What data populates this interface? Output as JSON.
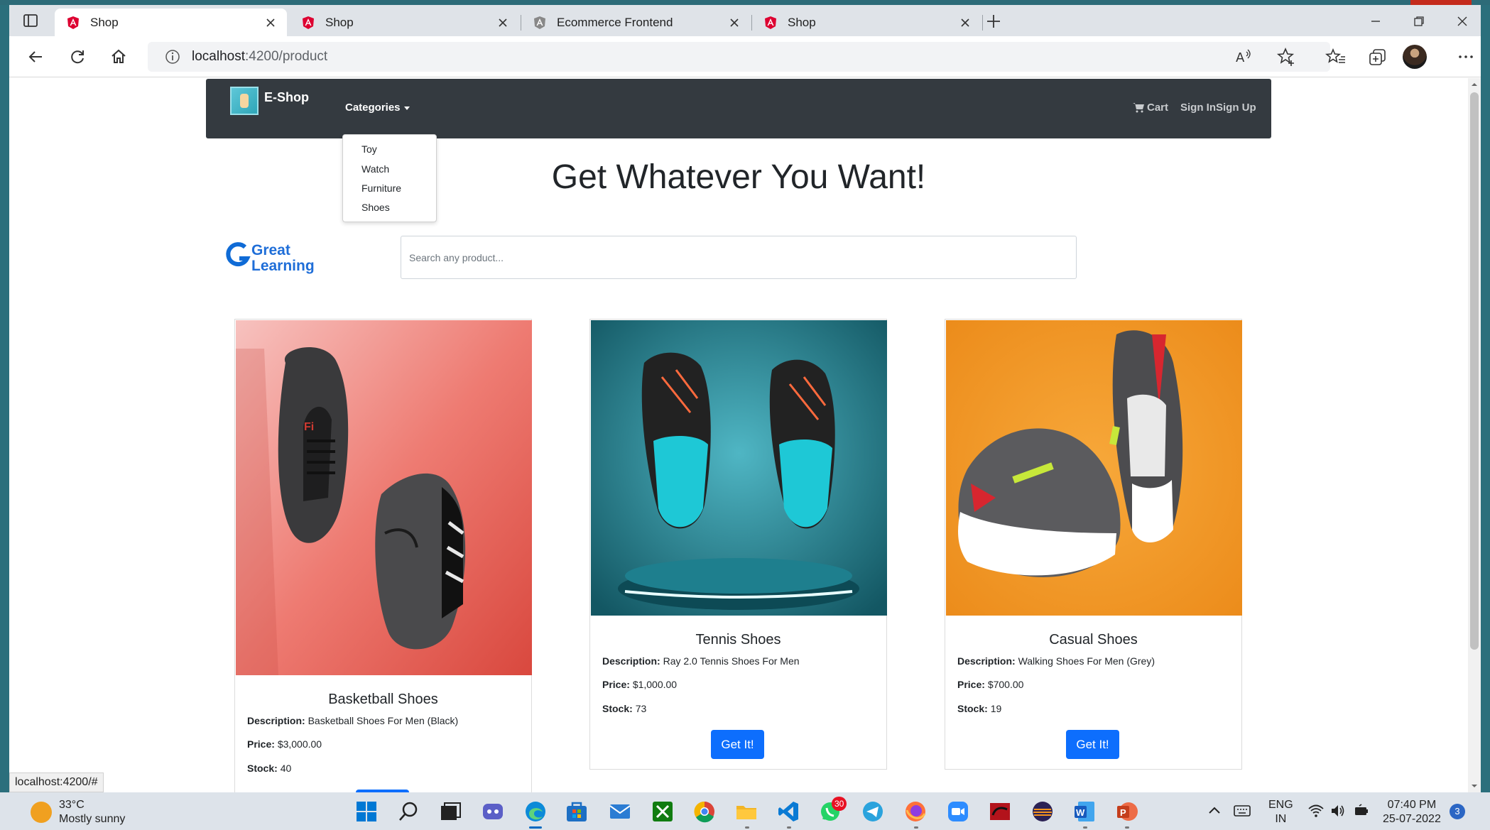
{
  "browser": {
    "tabs": [
      {
        "title": "Shop",
        "active": true
      },
      {
        "title": "Shop",
        "active": false
      },
      {
        "title": "Ecommerce Frontend",
        "active": false
      },
      {
        "title": "Shop",
        "active": false
      }
    ],
    "url_host": "localhost",
    "url_rest": ":4200/product",
    "status_url": "localhost:4200/#"
  },
  "navbar": {
    "brand": "E-Shop",
    "categories_label": "Categories",
    "cart_label": "Cart",
    "signin_label": "Sign In",
    "signup_label": "Sign Up",
    "dropdown_items": [
      "Toy",
      "Watch",
      "Furniture",
      "Shoes"
    ]
  },
  "hero": {
    "title": "Get Whatever You Want!"
  },
  "logo": {
    "line1": "Great",
    "line2": "Learning"
  },
  "search": {
    "placeholder": "Search any product..."
  },
  "labels": {
    "description": "Description:",
    "price": "Price:",
    "stock": "Stock:",
    "button": "Get It!"
  },
  "products": [
    {
      "name": "Basketball Shoes",
      "description": "Basketball Shoes For Men (Black)",
      "price": "$3,000.00",
      "stock": "40"
    },
    {
      "name": "Tennis Shoes",
      "description": "Ray 2.0 Tennis Shoes For Men",
      "price": "$1,000.00",
      "stock": "73"
    },
    {
      "name": "Casual Shoes",
      "description": "Walking Shoes For Men (Grey)",
      "price": "$700.00",
      "stock": "19"
    }
  ],
  "taskbar": {
    "weather_temp": "33°C",
    "weather_desc": "Mostly sunny",
    "whatsapp_badge": "30",
    "lang_1": "ENG",
    "lang_2": "IN",
    "time": "07:40 PM",
    "date": "25-07-2022",
    "notifications": "3"
  },
  "colors": {
    "navbar": "#343a40",
    "primary_button": "#0d6efd",
    "taskbar": "#dde3ea"
  }
}
